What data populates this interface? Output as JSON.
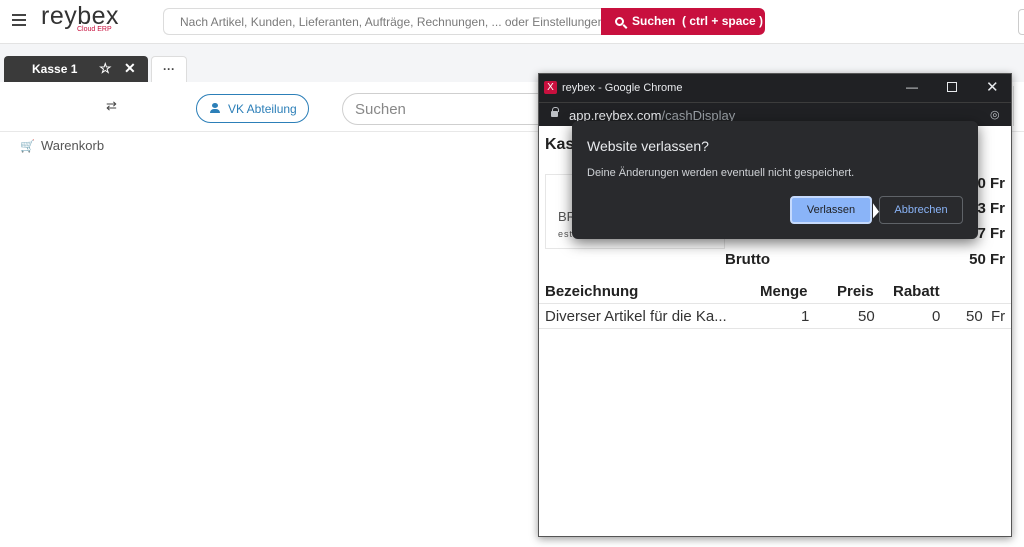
{
  "header": {
    "logo": "reybex",
    "logo_sub": "Cloud ERP",
    "search_placeholder": "Nach Artikel, Kunden, Lieferanten, Aufträge, Rechnungen, ... oder Einstellungen",
    "search_button": "Suchen",
    "search_shortcut": "( ctrl + space )"
  },
  "tabs": {
    "active_label": "Kasse 1",
    "more_label": "···"
  },
  "toolbar": {
    "vk_button": "VK Abteilung",
    "search_placeholder": "Suchen"
  },
  "cart": {
    "label": "Warenkorb"
  },
  "popup": {
    "window_title": "reybex - Google Chrome",
    "url_host": "app.reybex.com",
    "url_path": "/cashDisplay",
    "page_title_partial": "Kas",
    "brand_partial": "BR",
    "brand_sub_partial": "est",
    "totals": [
      "0 Fr",
      "3 Fr",
      "7 Fr"
    ],
    "brutto_label": "Brutto",
    "brutto_value": "50 Fr",
    "table": {
      "headers": [
        "Bezeichnung",
        "Menge",
        "Preis",
        "Rabatt"
      ],
      "rows": [
        {
          "name": "Diverser Artikel für die Ka...",
          "qty": "1",
          "price": "50",
          "discount": "0",
          "total": "50",
          "currency": "Fr"
        }
      ]
    }
  },
  "dialog": {
    "title": "Website verlassen?",
    "message": "Deine Änderungen werden eventuell nicht gespeichert.",
    "leave_button": "Verlassen",
    "cancel_button": "Abbrechen"
  },
  "colors": {
    "brand_red": "#c8103e",
    "accent_blue": "#2c7fb8",
    "dialog_bg": "#292a2d",
    "dialog_button": "#8ab4f8"
  }
}
